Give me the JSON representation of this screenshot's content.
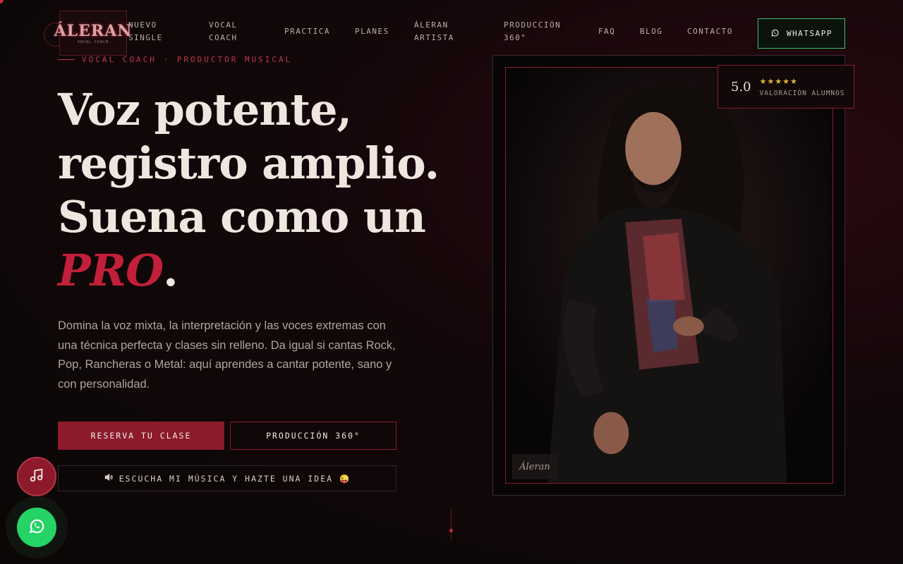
{
  "brand": {
    "logo_text": "ÁLERAN",
    "logo_sub": "VOCAL COACH"
  },
  "nav": {
    "items": [
      {
        "label": "NUEVO SINGLE",
        "id": "nuevo-single"
      },
      {
        "label": "VOCAL COACH",
        "id": "vocal-coach"
      },
      {
        "label": "PRACTICA",
        "id": "practica"
      },
      {
        "label": "PLANES",
        "id": "planes"
      },
      {
        "label": "ÁLERAN ARTISTA",
        "id": "aleran-artista"
      },
      {
        "label": "PRODUCCIÓN 360°",
        "id": "produccion-360"
      },
      {
        "label": "FAQ",
        "id": "faq"
      },
      {
        "label": "BLOG",
        "id": "blog"
      },
      {
        "label": "CONTACTO",
        "id": "contacto"
      }
    ],
    "whatsapp_label": "WHATSAPP"
  },
  "hero": {
    "eyebrow": "VOCAL COACH · PRODUCTOR MUSICAL",
    "headline": {
      "line1": "Voz potente,",
      "line2": "registro amplio.",
      "line3": "Suena como un",
      "highlight": "PRO",
      "period": "."
    },
    "lead": "Domina la voz mixta, la interpretación y las voces extremas con una técnica perfecta y clases sin relleno. Da igual si cantas Rock, Pop, Rancheras o Metal: aquí aprendes a cantar potente, sano y con personalidad.",
    "cta_primary": "RESERVA TU CLASE",
    "cta_secondary": "PRODUCCIÓN 360°",
    "cta_listen": "ESCUCHA MI MÚSICA Y HAZTE UNA IDEA 😜"
  },
  "rating": {
    "score": "5.0",
    "stars": "★★★★★",
    "label": "VALORACIÓN ALUMNOS"
  },
  "photo": {
    "caption": "Áleran"
  },
  "icons": {
    "whatsapp": "whatsapp-icon",
    "speaker": "speaker-icon",
    "music": "music-note-icon"
  },
  "colors": {
    "accent": "#8c1a2b",
    "accent_text": "#c21f3a",
    "whatsapp": "#25d366",
    "star": "#e0b33a"
  }
}
